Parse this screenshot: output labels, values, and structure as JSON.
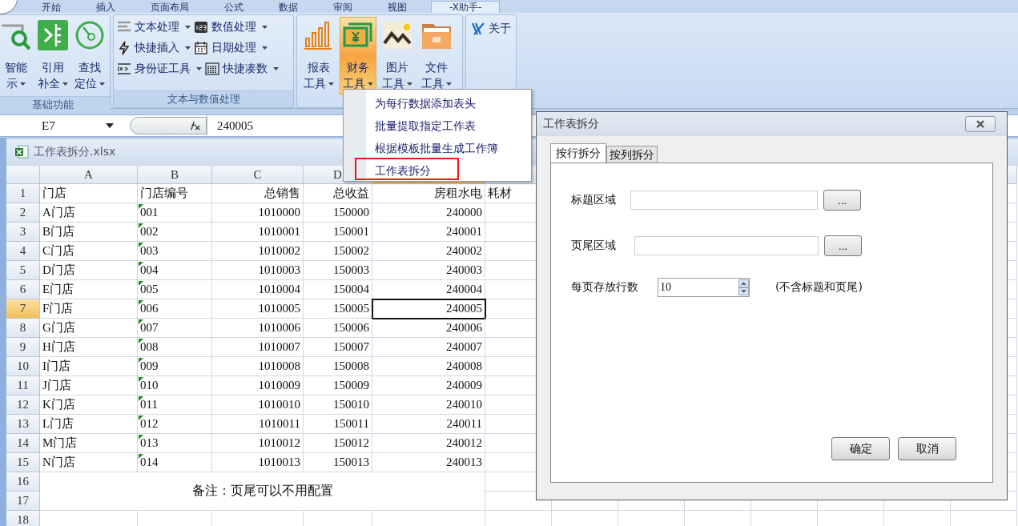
{
  "ribbon_tabs": [
    {
      "label": "开始",
      "selected": false
    },
    {
      "label": "插入",
      "selected": false
    },
    {
      "label": "页面布局",
      "selected": false
    },
    {
      "label": "公式",
      "selected": false
    },
    {
      "label": "数据",
      "selected": false
    },
    {
      "label": "审阅",
      "selected": false
    },
    {
      "label": "视图",
      "selected": false
    },
    {
      "label": "-X助手-",
      "selected": true
    }
  ],
  "ribbon_groups": [
    {
      "kind": "large",
      "label": "基础功能",
      "buttons": [
        {
          "lines": [
            "智能",
            "示"
          ],
          "selected": false
        },
        {
          "lines": [
            "引用",
            "补全"
          ],
          "selected": false
        },
        {
          "lines": [
            "查找",
            "定位"
          ],
          "selected": false
        }
      ]
    },
    {
      "kind": "small",
      "label": "文本与数值处理",
      "buttons": [
        {
          "label": "文本处理"
        },
        {
          "label": "数值处理"
        },
        {
          "label": "快捷插入"
        },
        {
          "label": "日期处理"
        },
        {
          "label": "身份证工具"
        },
        {
          "label": "快捷凑数"
        }
      ]
    },
    {
      "kind": "large",
      "buttons": [
        {
          "lines": [
            "报表",
            "工具"
          ],
          "selected": false
        },
        {
          "lines": [
            "财务",
            "工具"
          ],
          "selected": true
        },
        {
          "lines": [
            "图片",
            "工具"
          ],
          "selected": false
        },
        {
          "lines": [
            "文件",
            "工具"
          ],
          "selected": false
        }
      ]
    },
    {
      "kind": "about",
      "buttons": [
        {
          "label": "关于"
        }
      ]
    }
  ],
  "name_box": "E7",
  "formula": "240005",
  "workbook": {
    "title": "工作表拆分.xlsx",
    "column_headers": [
      "A",
      "B",
      "C",
      "D"
    ],
    "rows": [
      {
        "number": "1",
        "cells": [
          "门店",
          "门店编号",
          "总销售",
          "总收益",
          "房租水电",
          "耗材"
        ],
        "number_as_text": false
      },
      {
        "number": "2",
        "cells": [
          "A门店",
          "001",
          "1010000",
          "150000",
          "240000"
        ],
        "number_as_text": true
      },
      {
        "number": "3",
        "cells": [
          "B门店",
          "002",
          "1010001",
          "150001",
          "240001"
        ],
        "number_as_text": true
      },
      {
        "number": "4",
        "cells": [
          "C门店",
          "003",
          "1010002",
          "150002",
          "240002"
        ],
        "number_as_text": true
      },
      {
        "number": "5",
        "cells": [
          "D门店",
          "004",
          "1010003",
          "150003",
          "240003"
        ],
        "number_as_text": true
      },
      {
        "number": "6",
        "cells": [
          "E门店",
          "005",
          "1010004",
          "150004",
          "240004"
        ],
        "number_as_text": true
      },
      {
        "number": "7",
        "cells": [
          "F门店",
          "006",
          "1010005",
          "150005",
          "240005"
        ],
        "number_as_text": true
      },
      {
        "number": "8",
        "cells": [
          "G门店",
          "007",
          "1010006",
          "150006",
          "240006"
        ],
        "number_as_text": true
      },
      {
        "number": "9",
        "cells": [
          "H门店",
          "008",
          "1010007",
          "150007",
          "240007"
        ],
        "number_as_text": true
      },
      {
        "number": "10",
        "cells": [
          "I门店",
          "009",
          "1010008",
          "150008",
          "240008"
        ],
        "number_as_text": true
      },
      {
        "number": "11",
        "cells": [
          "J门店",
          "010",
          "1010009",
          "150009",
          "240009"
        ],
        "number_as_text": true
      },
      {
        "number": "12",
        "cells": [
          "K门店",
          "011",
          "1010010",
          "150010",
          "240010"
        ],
        "number_as_text": true
      },
      {
        "number": "13",
        "cells": [
          "L门店",
          "012",
          "1010011",
          "150011",
          "240011"
        ],
        "number_as_text": true
      },
      {
        "number": "14",
        "cells": [
          "M门店",
          "013",
          "1010012",
          "150012",
          "240012"
        ],
        "number_as_text": true
      },
      {
        "number": "15",
        "cells": [
          "N门店",
          "014",
          "1010013",
          "150013",
          "240013"
        ],
        "number_as_text": true
      }
    ],
    "note_rows": [
      "16",
      "17"
    ],
    "note": "备注：页尾可以不用配置",
    "last_row": "18"
  },
  "menu": {
    "items": [
      {
        "label": "为每行数据添加表头",
        "highlighted": false
      },
      {
        "label": "批量提取指定工作表",
        "highlighted": false
      },
      {
        "label": "根据模板批量生成工作簿",
        "highlighted": false
      },
      {
        "label": "工作表拆分",
        "highlighted": true
      }
    ]
  },
  "dialog": {
    "title": "工作表拆分",
    "tabs": [
      {
        "label": "按行拆分",
        "selected": true
      },
      {
        "label": "按列拆分",
        "selected": false
      }
    ],
    "fields": [
      {
        "label": "标题区域",
        "button": "..."
      },
      {
        "label": "页尾区域",
        "button": "..."
      }
    ],
    "spinner": {
      "label": "每页存放行数",
      "value": "10",
      "hint": "(不含标题和页尾)"
    },
    "buttons": [
      "确定",
      "取消"
    ]
  }
}
